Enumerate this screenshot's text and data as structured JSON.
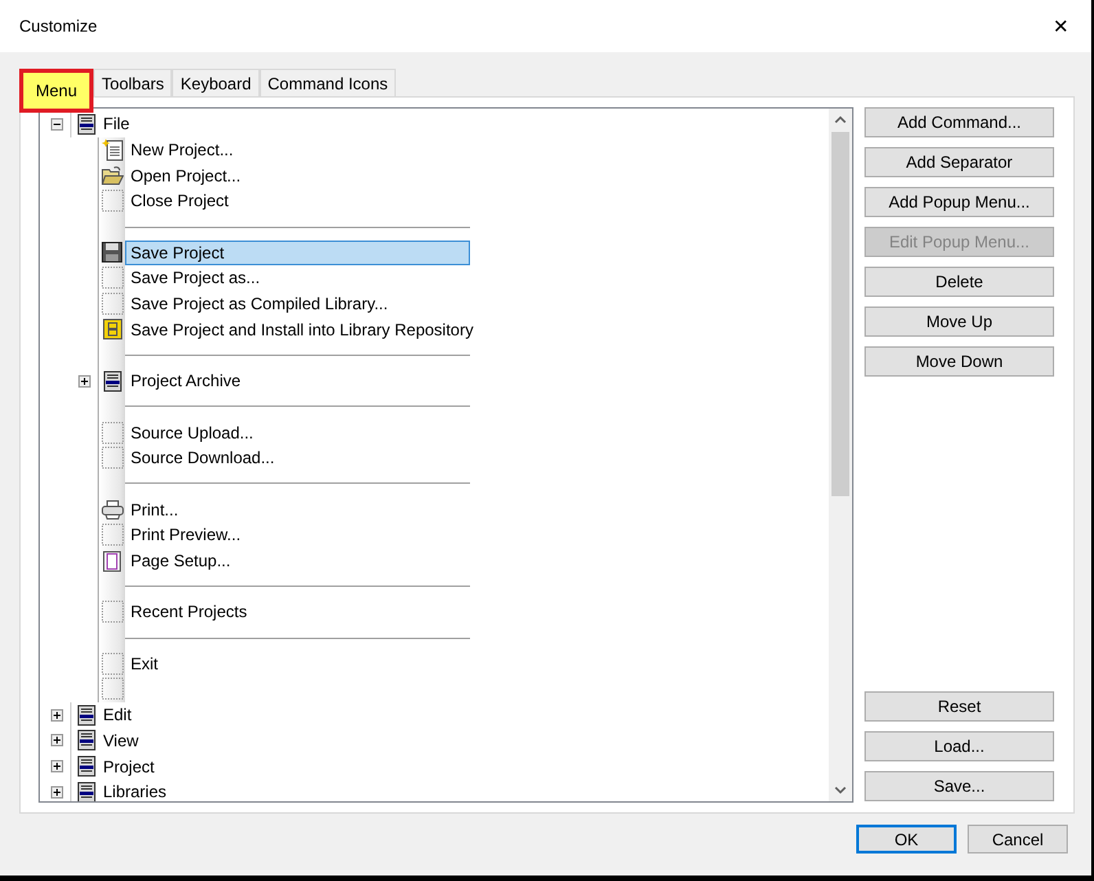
{
  "window": {
    "title": "Customize",
    "close": "✕"
  },
  "tabs": [
    {
      "label": "Menu",
      "selected": true
    },
    {
      "label": "Toolbars",
      "selected": false
    },
    {
      "label": "Keyboard",
      "selected": false
    },
    {
      "label": "Command Icons",
      "selected": false
    }
  ],
  "tree": [
    {
      "label": "File",
      "expanded": true,
      "selected": false,
      "children": [
        {
          "kind": "new",
          "label": "New Project...",
          "selected": false
        },
        {
          "kind": "open",
          "label": "Open Project...",
          "selected": false
        },
        {
          "kind": "blank",
          "label": "Close Project",
          "selected": false
        },
        {
          "kind": "separator"
        },
        {
          "kind": "save",
          "label": "Save Project",
          "selected": true
        },
        {
          "kind": "blank",
          "label": "Save Project as...",
          "selected": false
        },
        {
          "kind": "blank",
          "label": "Save Project as Compiled Library...",
          "selected": false
        },
        {
          "kind": "install",
          "label": "Save Project and Install into Library Repository",
          "selected": false
        },
        {
          "kind": "separator"
        },
        {
          "kind": "menu",
          "label": "Project Archive",
          "selected": false,
          "expanded": false
        },
        {
          "kind": "separator"
        },
        {
          "kind": "blank",
          "label": "Source Upload...",
          "selected": false
        },
        {
          "kind": "blank",
          "label": "Source Download...",
          "selected": false
        },
        {
          "kind": "separator"
        },
        {
          "kind": "print",
          "label": "Print...",
          "selected": false
        },
        {
          "kind": "blank",
          "label": "Print Preview...",
          "selected": false
        },
        {
          "kind": "page",
          "label": "Page Setup...",
          "selected": false
        },
        {
          "kind": "separator"
        },
        {
          "kind": "blank",
          "label": "Recent Projects",
          "selected": false
        },
        {
          "kind": "separator"
        },
        {
          "kind": "blank",
          "label": "Exit",
          "selected": false
        },
        {
          "kind": "blank"
        }
      ]
    },
    {
      "label": "Edit",
      "expanded": false,
      "selected": false
    },
    {
      "label": "View",
      "expanded": false,
      "selected": false
    },
    {
      "label": "Project",
      "expanded": false,
      "selected": false
    },
    {
      "label": "Libraries",
      "expanded": false,
      "selected": false
    }
  ],
  "side_buttons": [
    {
      "label": "Add Command...",
      "disabled": false
    },
    {
      "label": "Add Separator",
      "disabled": false
    },
    {
      "label": "Add Popup Menu...",
      "disabled": false
    },
    {
      "label": "Edit Popup Menu...",
      "disabled": true
    },
    {
      "label": "Delete",
      "disabled": false
    },
    {
      "label": "Move Up",
      "disabled": false
    },
    {
      "label": "Move Down",
      "disabled": false
    }
  ],
  "file_buttons": [
    {
      "label": "Reset"
    },
    {
      "label": "Load..."
    },
    {
      "label": "Save..."
    }
  ],
  "dialog_buttons": [
    {
      "label": "OK",
      "default": true
    },
    {
      "label": "Cancel",
      "default": false
    }
  ]
}
